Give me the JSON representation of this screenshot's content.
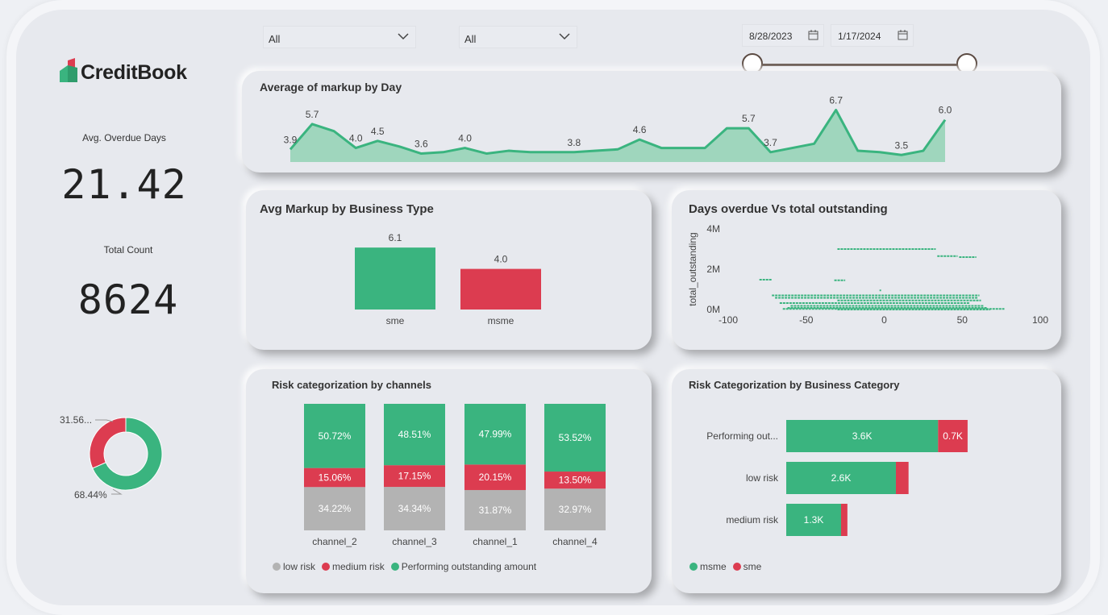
{
  "brand": {
    "name": "CreditBook"
  },
  "filters": {
    "dropdown1": "All",
    "dropdown2": "All",
    "date_start": "8/28/2023",
    "date_end": "1/17/2024"
  },
  "kpis": {
    "overdue_label": "Avg. Overdue Days",
    "overdue_value": "21.42",
    "count_label": "Total Count",
    "count_value": "8624"
  },
  "colors": {
    "green": "#3ab47f",
    "red": "#dc3c50",
    "grey": "#b3b3b3",
    "area": "#9fd6bd"
  },
  "chart_data": [
    {
      "type": "pie",
      "title": "",
      "labels": [
        "31.56...",
        "68.44%"
      ],
      "values": [
        31.56,
        68.44
      ],
      "colors": [
        "#dc3c50",
        "#3ab47f"
      ]
    },
    {
      "type": "area",
      "title": "Average of markup by Day",
      "values": [
        3.9,
        5.7,
        5.2,
        4.0,
        4.5,
        4.1,
        3.6,
        3.7,
        4.0,
        3.6,
        3.8,
        3.7,
        3.7,
        3.7,
        3.8,
        3.9,
        4.6,
        4.0,
        4.0,
        4.0,
        5.4,
        5.4,
        3.7,
        4.0,
        4.3,
        6.7,
        3.8,
        3.7,
        3.5,
        3.8,
        6.0
      ],
      "labels": [
        "3.9",
        "5.7",
        "",
        "4.0",
        "4.5",
        "",
        "3.6",
        "",
        "4.0",
        "",
        "",
        "",
        "",
        "3.8",
        "",
        "",
        "4.6",
        "",
        "",
        "",
        "",
        "5.7",
        "3.7",
        "",
        "",
        "6.7",
        "",
        "",
        "3.5",
        "",
        "6.0"
      ]
    },
    {
      "type": "bar",
      "title": "Avg Markup by Business Type",
      "categories": [
        "sme",
        "msme"
      ],
      "values": [
        6.1,
        4.0
      ],
      "value_labels": [
        "6.1",
        "4.0"
      ]
    },
    {
      "type": "scatter",
      "title": "Days overdue Vs total outstanding",
      "ylabel": "total_outstanding",
      "xlim": [
        -100,
        100
      ],
      "ylim": [
        0,
        4000000
      ],
      "x_ticks": [
        "-100",
        "-50",
        "0",
        "50",
        "100"
      ],
      "y_ticks": [
        "0M",
        "2M",
        "4M"
      ],
      "segments": [
        {
          "x1": -30,
          "x2": 33,
          "y": 3000000
        },
        {
          "x1": 34,
          "x2": 47,
          "y": 2650000
        },
        {
          "x1": 48,
          "x2": 59,
          "y": 2600000
        },
        {
          "x1": -80,
          "x2": -72,
          "y": 1480000
        },
        {
          "x1": -32,
          "x2": -25,
          "y": 1450000
        },
        {
          "x1": -3,
          "x2": -2,
          "y": 950000
        },
        {
          "x1": -72,
          "x2": 61,
          "y": 700000
        },
        {
          "x1": -70,
          "x2": 60,
          "y": 580000
        },
        {
          "x1": -30,
          "x2": 62,
          "y": 450000
        },
        {
          "x1": -67,
          "x2": 55,
          "y": 320000
        },
        {
          "x1": -60,
          "x2": 64,
          "y": 180000
        },
        {
          "x1": -62,
          "x2": 66,
          "y": 80000
        },
        {
          "x1": -65,
          "x2": 77,
          "y": 30000
        },
        {
          "x1": -30,
          "x2": 68,
          "y": 0
        }
      ]
    },
    {
      "type": "bar",
      "title": "Risk categorization by channels",
      "categories": [
        "channel_2",
        "channel_3",
        "channel_1",
        "channel_4"
      ],
      "series": [
        {
          "name": "low risk",
          "values": [
            34.22,
            34.34,
            31.87,
            32.97
          ],
          "labels": [
            "34.22%",
            "34.34%",
            "31.87%",
            "32.97%"
          ]
        },
        {
          "name": "medium risk",
          "values": [
            15.06,
            17.15,
            20.15,
            13.5
          ],
          "labels": [
            "15.06%",
            "17.15%",
            "20.15%",
            "13.50%"
          ]
        },
        {
          "name": "Performing outstanding amount",
          "values": [
            50.72,
            48.51,
            47.99,
            53.52
          ],
          "labels": [
            "50.72%",
            "48.51%",
            "47.99%",
            "53.52%"
          ]
        }
      ]
    },
    {
      "type": "bar",
      "title": "Risk Categorization by Business Category",
      "categories": [
        "Performing out...",
        "low risk",
        "medium risk"
      ],
      "series": [
        {
          "name": "msme",
          "values": [
            3600,
            2600,
            1300
          ],
          "labels": [
            "3.6K",
            "2.6K",
            "1.3K"
          ]
        },
        {
          "name": "sme",
          "values": [
            700,
            300,
            150
          ],
          "labels": [
            "0.7K",
            "",
            ""
          ]
        }
      ]
    }
  ]
}
